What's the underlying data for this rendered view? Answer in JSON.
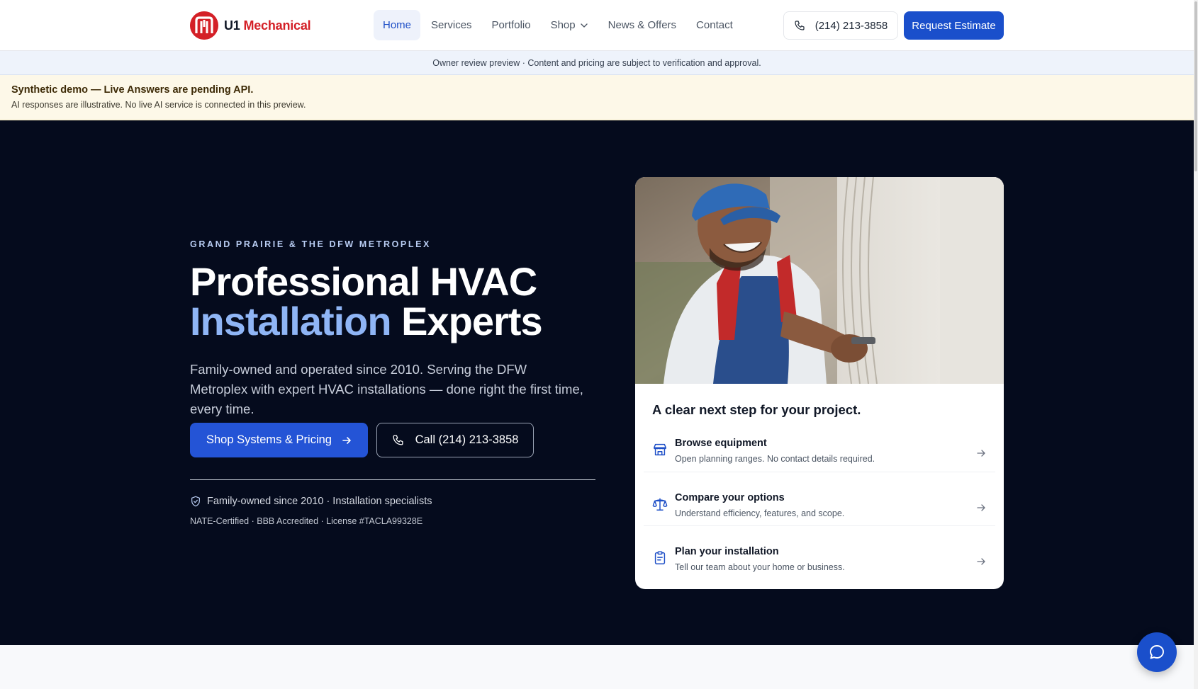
{
  "brand": {
    "name_part1": "U1",
    "name_part2": "Mechanical",
    "red": "#d42027"
  },
  "nav": {
    "items": [
      {
        "label": "Home",
        "active": true
      },
      {
        "label": "Services"
      },
      {
        "label": "Portfolio"
      },
      {
        "label": "Shop",
        "has_dropdown": true
      },
      {
        "label": "News & Offers"
      },
      {
        "label": "Contact"
      }
    ],
    "phone": "(214) 213-3858",
    "estimate_label": "Request Estimate"
  },
  "preview_notice": "Owner review preview · Content and pricing are subject to verification and approval.",
  "demo_banner": {
    "title": "Synthetic demo — Live Answers are pending API.",
    "subtitle": "AI responses are illustrative. No live AI service is connected in this preview."
  },
  "hero": {
    "eyebrow": "GRAND PRAIRIE & THE DFW METROPLEX",
    "title_line1": "Professional HVAC",
    "title_accent": "Installation",
    "title_rest": "Experts",
    "lead": "Family-owned and operated since 2010. Serving the DFW Metroplex with expert HVAC installations — done right the first time, every time.",
    "cta_primary": "Shop Systems & Pricing",
    "cta_secondary": "Call (214) 213-3858",
    "trust_line": "Family-owned since 2010 · Installation specialists",
    "credentials": "NATE-Certified · BBB Accredited · License #TACLA99328E",
    "colors": {
      "background": "#050b1d",
      "accent": "#8fb5f5",
      "primary_button": "#2454d6"
    }
  },
  "card": {
    "heading": "A clear next step for your project.",
    "steps": [
      {
        "title": "Browse equipment",
        "desc": "Open planning ranges. No contact details required.",
        "icon": "storefront-icon"
      },
      {
        "title": "Compare your options",
        "desc": "Understand efficiency, features, and scope.",
        "icon": "scale-icon"
      },
      {
        "title": "Plan your installation",
        "desc": "Tell our team about your home or business.",
        "icon": "clipboard-icon"
      }
    ]
  }
}
